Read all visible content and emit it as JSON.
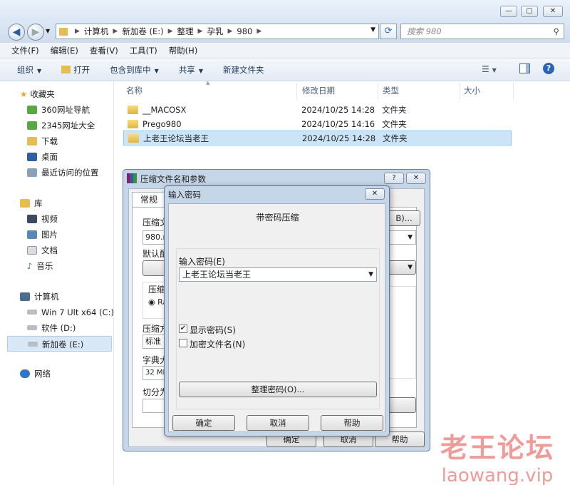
{
  "address": {
    "crumbs": [
      "计算机",
      "新加卷 (E:)",
      "整理",
      "孕乳",
      "980"
    ]
  },
  "search": {
    "placeholder": "搜索 980"
  },
  "menu": [
    "文件(F)",
    "编辑(E)",
    "查看(V)",
    "工具(T)",
    "帮助(H)"
  ],
  "toolbar": {
    "organize": "组织",
    "open": "打开",
    "include": "包含到库中",
    "share": "共享",
    "new_folder": "新建文件夹"
  },
  "sidebar": {
    "favorites": "收藏夹",
    "fav_items": [
      "360网址导航",
      "2345网址大全",
      "下载",
      "桌面",
      "最近访问的位置"
    ],
    "libraries": "库",
    "lib_items": [
      "视频",
      "图片",
      "文档",
      "音乐"
    ],
    "computer": "计算机",
    "drives": [
      "Win 7 Ult x64 (C:)",
      "软件 (D:)",
      "新加卷 (E:)"
    ],
    "network": "网络"
  },
  "columns": {
    "name": "名称",
    "date": "修改日期",
    "type": "类型",
    "size": "大小"
  },
  "files": [
    {
      "name": "__MACOSX",
      "date": "2024/10/25 14:28",
      "type": "文件夹"
    },
    {
      "name": "Prego980",
      "date": "2024/10/25 14:16",
      "type": "文件夹"
    },
    {
      "name": "上老王论坛当老王",
      "date": "2024/10/25 14:28",
      "type": "文件夹"
    }
  ],
  "archive_dialog": {
    "title": "压缩文件名和参数",
    "tab": "常规",
    "labels": [
      "压缩文",
      "默认配",
      "压缩",
      "压缩方",
      "字典大",
      "切分为"
    ],
    "filename": "980.ra",
    "browse": "B)...",
    "radio": "Ra",
    "method": "标准",
    "dict": "32 MB",
    "ok": "确定",
    "cancel": "取消",
    "help": "帮助"
  },
  "password_dialog": {
    "title": "输入密码",
    "heading": "带密码压缩",
    "label": "输入密码(E)",
    "value": "上老王论坛当老王",
    "show_password": "显示密码(S)",
    "show_password_checked": true,
    "encrypt_names": "加密文件名(N)",
    "encrypt_names_checked": false,
    "manage": "整理密码(O)...",
    "ok": "确定",
    "cancel": "取消",
    "help": "帮助"
  },
  "watermark": {
    "cn": "老王论坛",
    "url": "laowang.vip"
  }
}
